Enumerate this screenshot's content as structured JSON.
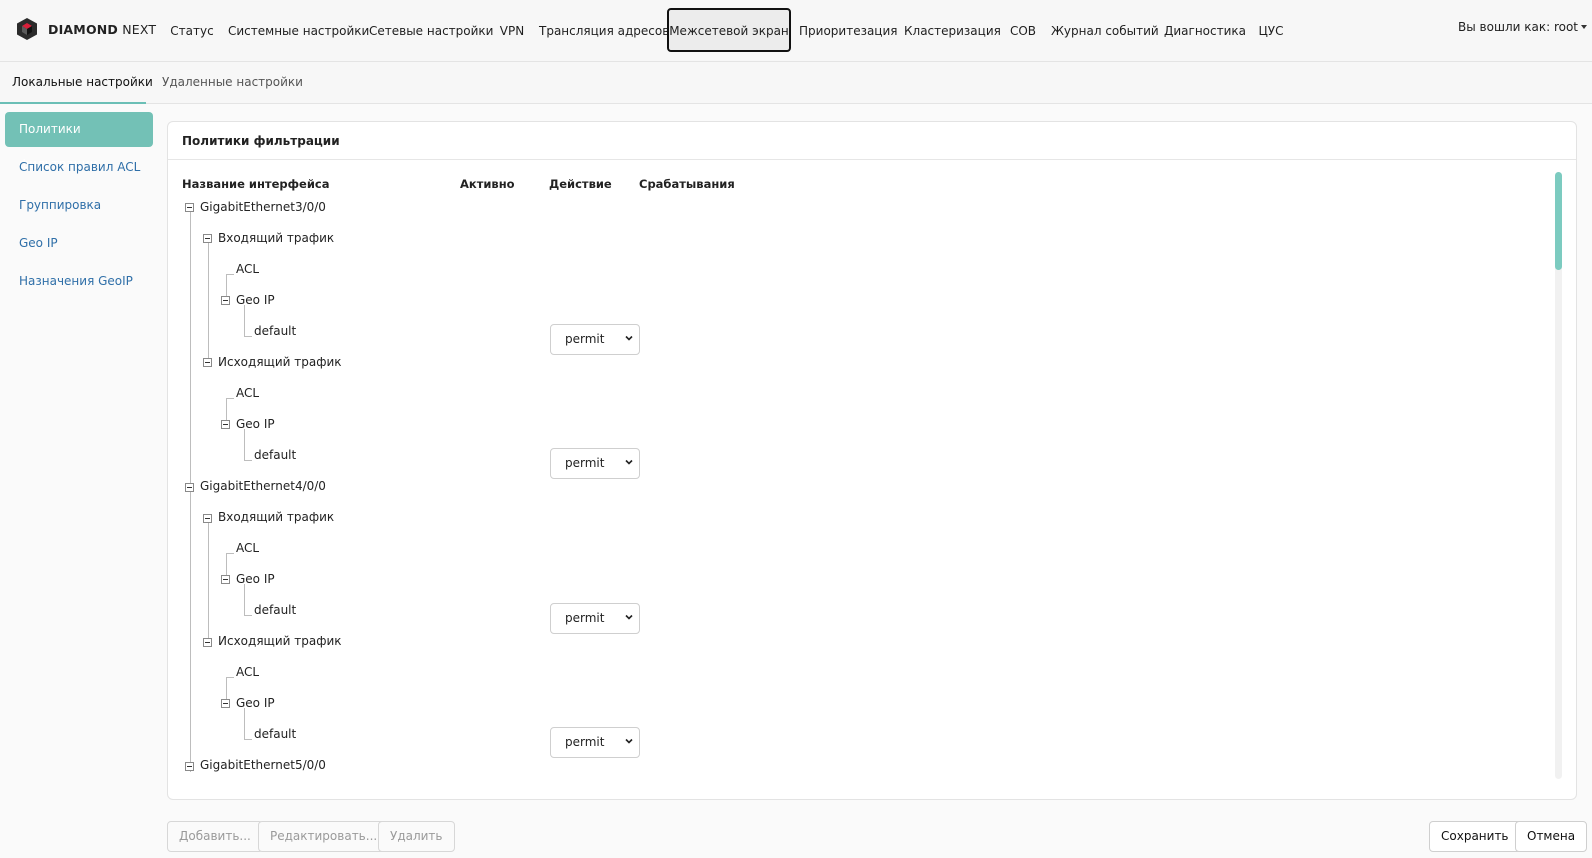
{
  "brand": {
    "name_bold": "DIAMOND",
    "name_light": " NEXT",
    "colors": {
      "logo_main": "#2b2b2b",
      "logo_accent": "#d81f3a"
    }
  },
  "nav": {
    "items": [
      {
        "label": "Статус"
      },
      {
        "label": "Системные настройки"
      },
      {
        "label": "Сетевые настройки"
      },
      {
        "label": "VPN"
      },
      {
        "label": "Трансляция адресов"
      },
      {
        "label": "Межсетевой экран"
      },
      {
        "label": "Приоритезация"
      },
      {
        "label": "Кластеризация"
      },
      {
        "label": "СОВ"
      },
      {
        "label": "Журнал событий"
      },
      {
        "label": "Диагностика"
      },
      {
        "label": "ЦУС"
      }
    ],
    "active": "Межсетевой экран",
    "user_label": "Вы вошли как: root"
  },
  "subtabs": {
    "items": [
      {
        "label": "Локальные настройки"
      },
      {
        "label": "Удаленные настройки"
      }
    ],
    "active": "Локальные настройки"
  },
  "sidebar": {
    "items": [
      {
        "label": "Политики фильтрации"
      },
      {
        "label": "Список правил ACL"
      },
      {
        "label": "Группировка"
      },
      {
        "label": "Geo IP"
      },
      {
        "label": "Назначения GeoIP"
      }
    ],
    "active": "Политики фильтрации"
  },
  "panel": {
    "title": "Политики фильтрации",
    "columns": [
      "Название интерфейса",
      "Активно",
      "Действие",
      "Срабатывания"
    ],
    "tree": [
      {
        "label": "GigabitEthernet3/0/0"
      },
      {
        "label": "Входящий трафик"
      },
      {
        "label": "ACL"
      },
      {
        "label": "Geo IP"
      },
      {
        "label": "default",
        "action": "permit"
      },
      {
        "label": "Исходящий трафик"
      },
      {
        "label": "ACL"
      },
      {
        "label": "Geo IP"
      },
      {
        "label": "default",
        "action": "permit"
      },
      {
        "label": "GigabitEthernet4/0/0"
      },
      {
        "label": "Входящий трафик"
      },
      {
        "label": "ACL"
      },
      {
        "label": "Geo IP"
      },
      {
        "label": "default",
        "action": "permit"
      },
      {
        "label": "Исходящий трафик"
      },
      {
        "label": "ACL"
      },
      {
        "label": "Geo IP"
      },
      {
        "label": "default",
        "action": "permit"
      },
      {
        "label": "GigabitEthernet5/0/0"
      }
    ]
  },
  "buttons": {
    "add": "Добавить...",
    "edit": "Редактировать...",
    "delete": "Удалить",
    "save": "Сохранить",
    "cancel": "Отмена"
  },
  "colors": {
    "accent": "#73c1b6",
    "link": "#2f6fa8"
  }
}
